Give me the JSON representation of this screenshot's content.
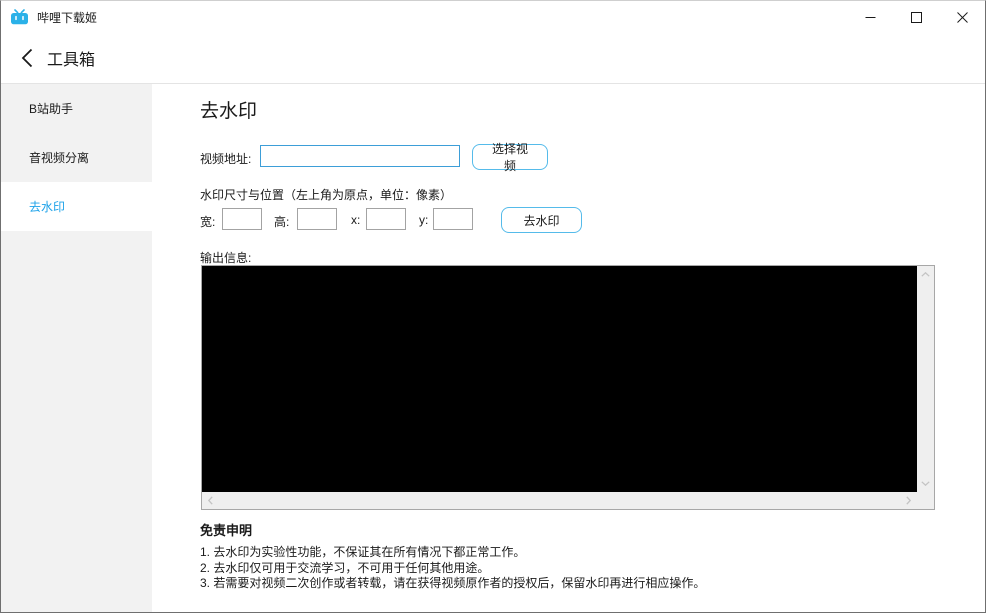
{
  "window": {
    "title": "哔哩下载姬"
  },
  "header": {
    "title": "工具箱"
  },
  "sidebar": {
    "items": [
      {
        "label": "B站助手",
        "active": false
      },
      {
        "label": "音视频分离",
        "active": false
      },
      {
        "label": "去水印",
        "active": true
      }
    ]
  },
  "main": {
    "title": "去水印",
    "video": {
      "label": "视频地址:",
      "value": "",
      "select_button": "选择视频"
    },
    "watermark": {
      "label": "水印尺寸与位置（左上角为原点，单位：像素）",
      "fields": [
        {
          "label": "宽:",
          "value": ""
        },
        {
          "label": "高:",
          "value": ""
        },
        {
          "label": "x:",
          "value": ""
        },
        {
          "label": "y:",
          "value": ""
        }
      ],
      "apply_button": "去水印"
    },
    "output": {
      "label": "输出信息:",
      "content": ""
    },
    "disclaimer": {
      "title": "免责申明",
      "lines": [
        "1. 去水印为实验性功能，不保证其在所有情况下都正常工作。",
        "2. 去水印仅可用于交流学习，不可用于任何其他用途。",
        "3. 若需要对视频二次创作或者转载，请在获得视频原作者的授权后，保留水印再进行相应操作。"
      ]
    }
  },
  "icons": {
    "app": "bilibili-tv-icon",
    "back": "chevron-left-icon",
    "minimize": "minimize-icon",
    "maximize": "maximize-icon",
    "close": "close-icon",
    "scroll": [
      "chevron-up-icon",
      "chevron-down-icon",
      "chevron-left-icon",
      "chevron-right-icon"
    ]
  },
  "colors": {
    "accent": "#1da2e9",
    "input_border": "#3d9ed8",
    "button_border": "#55bbea",
    "sidebar_bg": "#f2f2f2",
    "output_bg": "#000000",
    "output_border": "#a7a7a7",
    "scrollbar_track": "#efefef"
  }
}
